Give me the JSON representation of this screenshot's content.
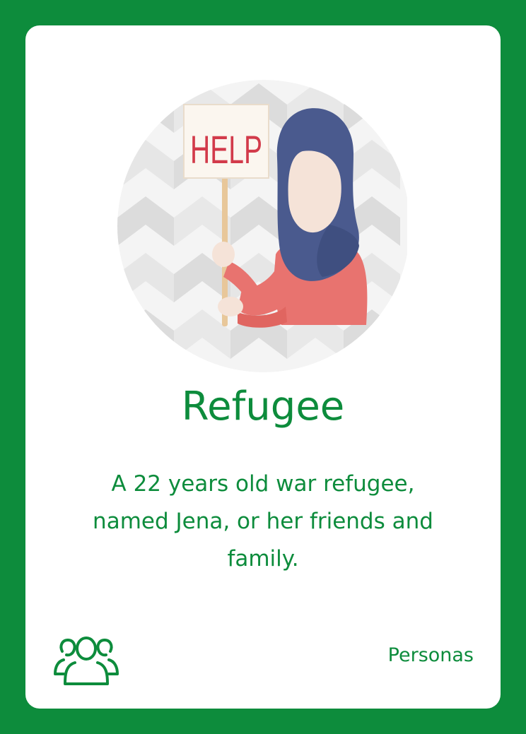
{
  "card": {
    "title": "Refugee",
    "description": "A 22 years old war refugee, named Jena, or her friends and family.",
    "category": "Personas",
    "sign_text": "HELP"
  },
  "icons": {
    "category_icon": "people-group-icon",
    "illustration": "refugee-holding-help-sign"
  },
  "colors": {
    "frame": "#0d8c3c",
    "accent_text": "#0d8c3c",
    "card_background": "#ffffff",
    "hijab": "#4a5a8e",
    "shirt": "#e8736f",
    "skin": "#f5e3d8",
    "sign_text": "#d23a4a"
  }
}
